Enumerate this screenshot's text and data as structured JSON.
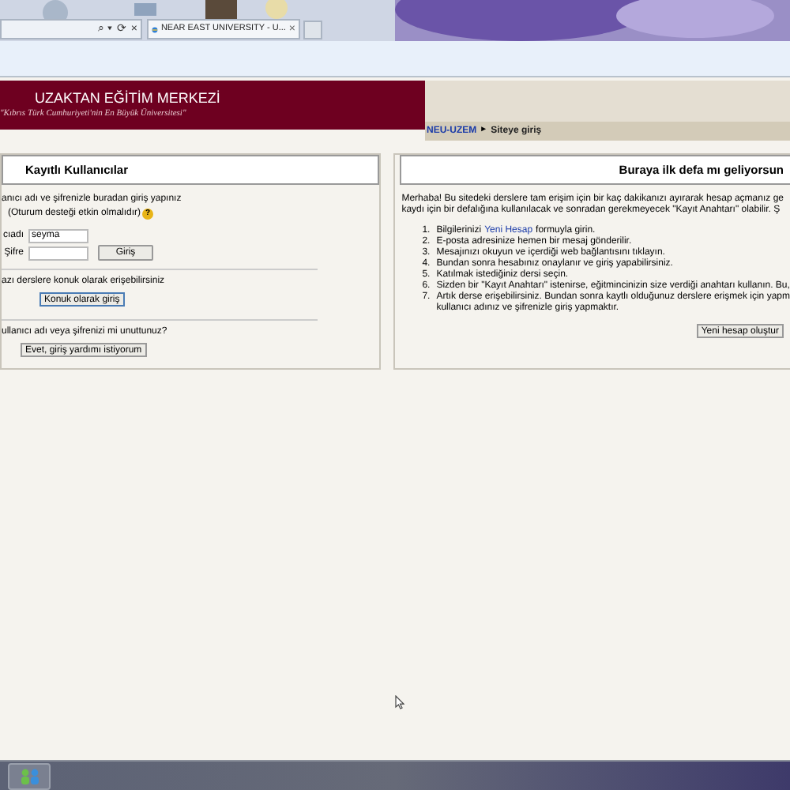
{
  "browser": {
    "tab_title": "NEAR EAST UNIVERSITY - U...",
    "tab_close": "×",
    "address_buttons": [
      "⌕ ▾",
      "⟳",
      "×"
    ]
  },
  "header": {
    "title": "UZAKTAN EĞİTİM MERKEZİ",
    "subtitle": "\"Kıbrıs Türk Cumhuriyeti'nin En Büyük Üniversitesi\""
  },
  "breadcrumb": {
    "home": "NEU-UZEM",
    "separator": "►",
    "current": "Siteye giriş"
  },
  "login": {
    "title": "Kayıtlı Kullanıcılar",
    "intro": "anıcı adı ve şifrenizle buradan giriş yapınız",
    "note": "(Oturum desteği etkin olmalıdır)",
    "help": "?",
    "fields": [
      {
        "label": "cıadı",
        "value": "seyma"
      },
      {
        "label": "Şifre"
      }
    ],
    "login_button": "Giriş",
    "guest_text": "azı derslere konuk olarak erişebilirsiniz",
    "guest_button": "Konuk olarak giriş",
    "forgot_text": "ullanıcı adı veya şifrenizi mi unuttunuz?",
    "forgot_button": "Evet, giriş yardımı istiyorum"
  },
  "signup": {
    "title": "Buraya ilk defa mı geliyorsun",
    "intro": [
      "Merhaba! Bu sitedeki derslere tam erişim için bir kaç dakikanızı ayırarak hesap açmanız ge",
      "kaydı için bir defalığına kullanılacak ve sonradan gerekmeyecek \"Kayıt Anahtarı\" olabilir. Ş"
    ],
    "steps": [
      {
        "number": "1.",
        "lines": [
          {
            "kind": "link",
            "before": "Bilgilerinizi",
            "link": "Yeni Hesap",
            "after": "formuyla girin."
          }
        ]
      },
      {
        "number": "2.",
        "lines": [
          "E-posta adresinize hemen bir mesaj gönderilir."
        ]
      },
      {
        "number": "3.",
        "lines": [
          "Mesajınızı okuyun ve içerdiği web bağlantısını tıklayın."
        ]
      },
      {
        "number": "4.",
        "lines": [
          "Bundan sonra hesabınız onaylanır ve giriş yapabilirsiniz."
        ]
      },
      {
        "number": "5.",
        "lines": [
          "Katılmak istediğiniz dersi seçin."
        ]
      },
      {
        "number": "6.",
        "lines": [
          "Sizden bir \"Kayıt Anahtarı\" istenirse, eğitmincinizin size verdiği anahtarı kullanın. Bu,"
        ]
      },
      {
        "number": "7.",
        "lines": [
          "Artık derse erişebilirsiniz. Bundan sonra kaytlı olduğunuz derslere erişmek için yapm",
          "kullanıcı adınız ve şifrenizle giriş yapmaktır."
        ]
      }
    ],
    "button": "Yeni hesap oluştur"
  }
}
